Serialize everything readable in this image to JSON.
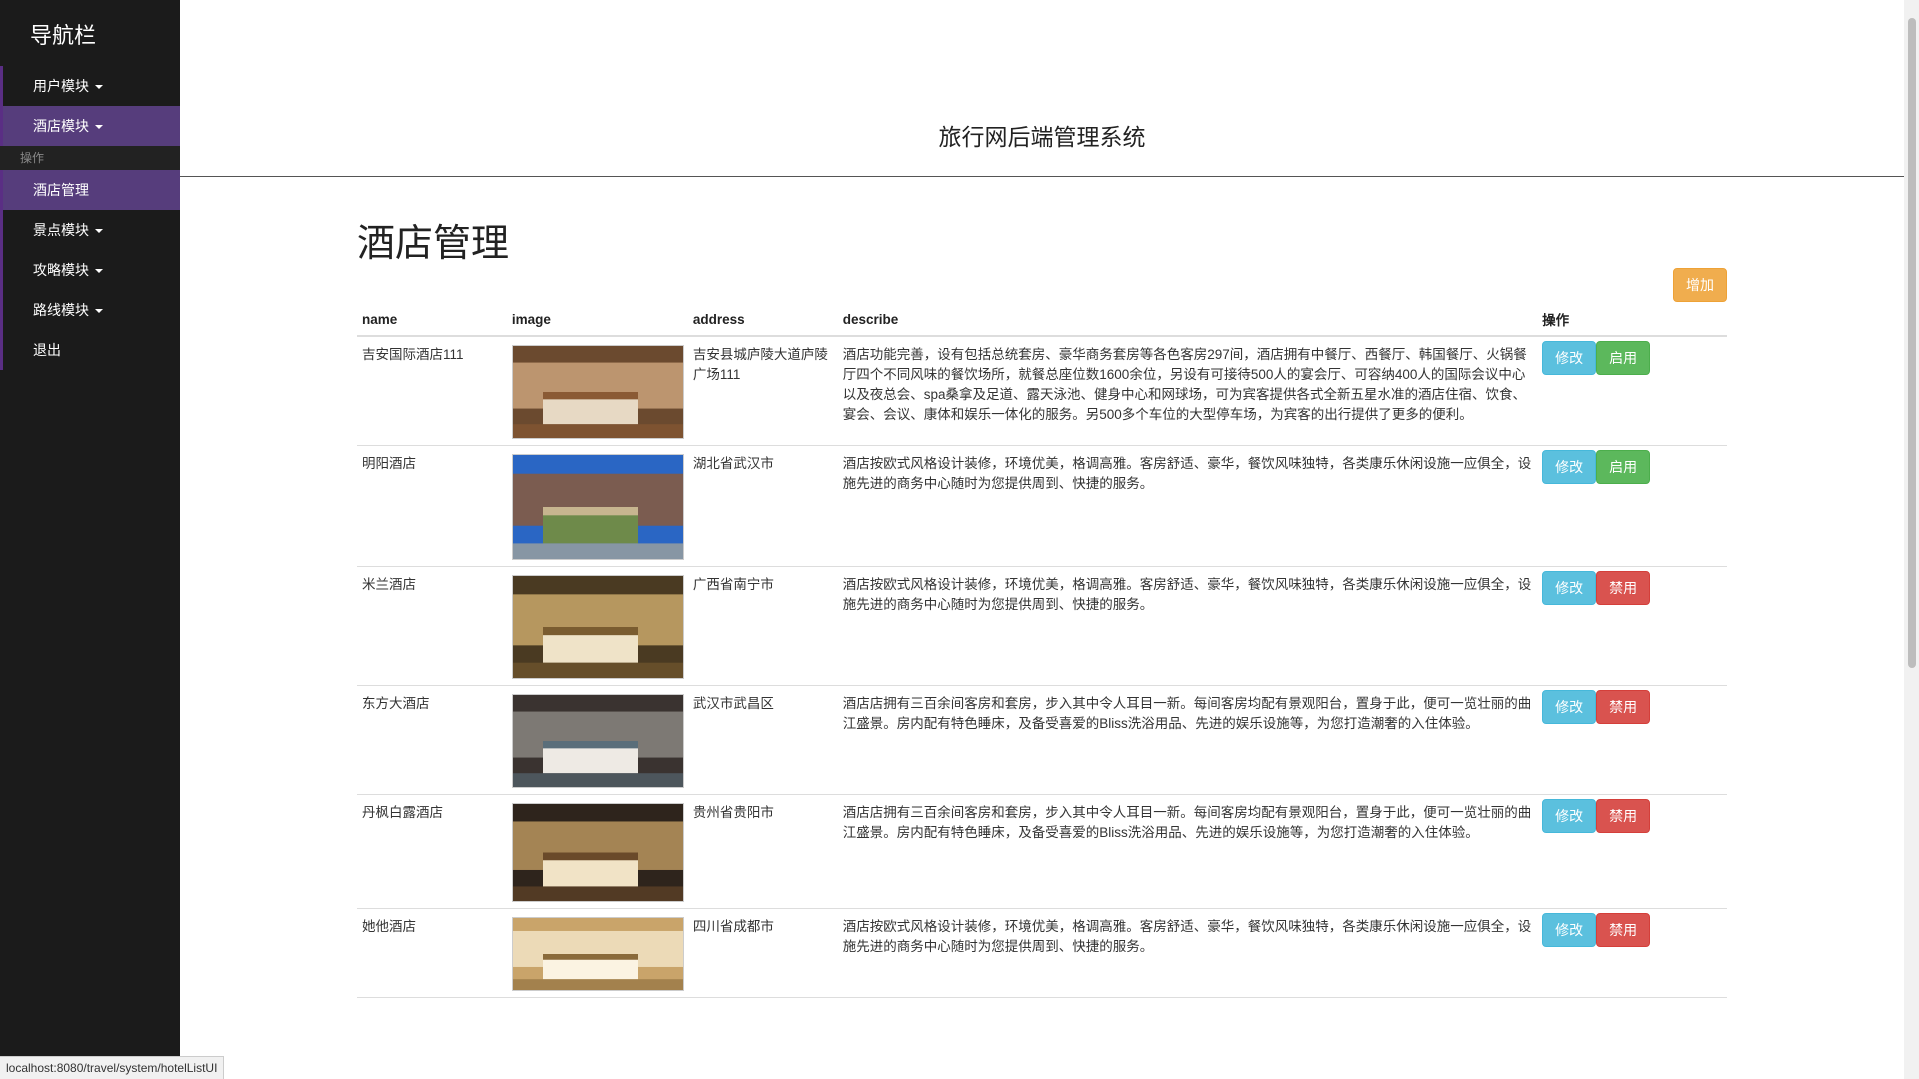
{
  "sidebar": {
    "brand": "导航栏",
    "items": [
      {
        "label": "用户模块",
        "caret": true,
        "active": false
      },
      {
        "label": "酒店模块",
        "caret": true,
        "active": true
      }
    ],
    "subheader": "操作",
    "subitem": {
      "label": "酒店管理",
      "active": true
    },
    "items2": [
      {
        "label": "景点模块",
        "caret": true
      },
      {
        "label": "攻略模块",
        "caret": true
      },
      {
        "label": "路线模块",
        "caret": true
      },
      {
        "label": "退出",
        "caret": false
      }
    ]
  },
  "header": {
    "title": "旅行网后端管理系统"
  },
  "main": {
    "title": "酒店管理",
    "add_label": "增加",
    "columns": [
      "name",
      "image",
      "address",
      "describe",
      "操作"
    ],
    "rows": [
      {
        "name": "吉安国际酒店111",
        "address": "吉安县城庐陵大道庐陵广场111",
        "describe": "酒店功能完善，设有包括总统套房、豪华商务套房等各色客房297间，酒店拥有中餐厅、西餐厅、韩国餐厅、火锅餐厅四个不同风味的餐饮场所，就餐总座位数1600余位，另设有可接待500人的宴会厅、可容纳400人的国际会议中心以及夜总会、spa桑拿及足道、露天泳池、健身中心和网球场，可为宾客提供各式全新五星水准的酒店住宿、饮食、宴会、会议、康体和娱乐一体化的服务。另500多个车位的大型停车场，为宾客的出行提供了更多的便利。",
        "edit": "修改",
        "toggle": "启用",
        "toggle_type": "success",
        "img": "room-warm"
      },
      {
        "name": "明阳酒店",
        "address": "湖北省武汉市",
        "describe": "酒店按欧式风格设计装修，环境优美，格调高雅。客房舒适、豪华，餐饮风味独特，各类康乐休闲设施一应俱全，设施先进的商务中心随时为您提供周到、快捷的服务。",
        "edit": "修改",
        "toggle": "启用",
        "toggle_type": "success",
        "img": "courtyard"
      },
      {
        "name": "米兰酒店",
        "address": "广西省南宁市",
        "describe": "酒店按欧式风格设计装修，环境优美，格调高雅。客房舒适、豪华，餐饮风味独特，各类康乐休闲设施一应俱全，设施先进的商务中心随时为您提供周到、快捷的服务。",
        "edit": "修改",
        "toggle": "禁用",
        "toggle_type": "danger",
        "img": "room-gold"
      },
      {
        "name": "东方大酒店",
        "address": "武汉市武昌区",
        "describe": "酒店店拥有三百余间客房和套房，步入其中令人耳目一新。每间客房均配有景观阳台，置身于此，便可一览壮丽的曲江盛景。房内配有特色睡床，及备受喜爱的Bliss洗浴用品、先进的娱乐设施等，为您打造潮奢的入住体验。",
        "edit": "修改",
        "toggle": "禁用",
        "toggle_type": "danger",
        "img": "room-modern"
      },
      {
        "name": "丹枫白露酒店",
        "address": "贵州省贵阳市",
        "describe": "酒店店拥有三百余间客房和套房，步入其中令人耳目一新。每间客房均配有景观阳台，置身于此，便可一览壮丽的曲江盛景。房内配有特色睡床，及备受喜爱的Bliss洗浴用品、先进的娱乐设施等，为您打造潮奢的入住体验。",
        "edit": "修改",
        "toggle": "禁用",
        "toggle_type": "danger",
        "img": "room-dark"
      },
      {
        "name": "她他酒店",
        "address": "四川省成都市",
        "describe": "酒店按欧式风格设计装修，环境优美，格调高雅。客房舒适、豪华，餐饮风味独特，各类康乐休闲设施一应俱全，设施先进的商务中心随时为您提供周到、快捷的服务。",
        "edit": "修改",
        "toggle": "禁用",
        "toggle_type": "danger",
        "img": "room-light"
      }
    ]
  },
  "status_url": "localhost:8080/travel/system/hotelListUI",
  "colors": {
    "sidebar_bg": "#1b1b1b",
    "active": "#563d7c",
    "info": "#5bc0de",
    "success": "#5cb85c",
    "danger": "#d9534f",
    "warning": "#f0ad4e"
  }
}
